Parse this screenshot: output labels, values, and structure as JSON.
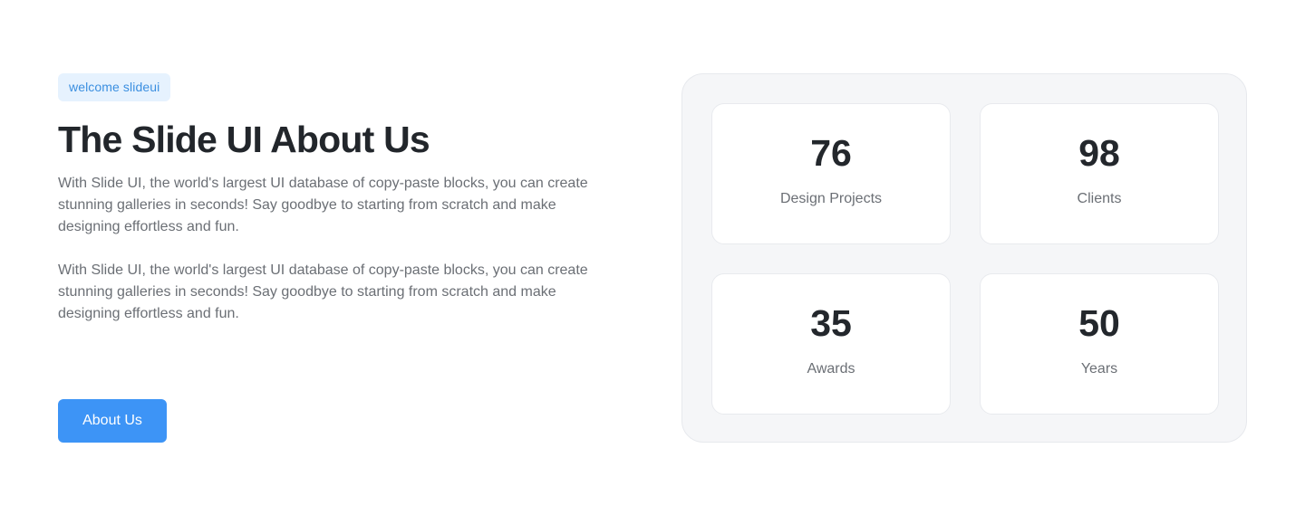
{
  "hero": {
    "badge": "welcome slideui",
    "title": "The Slide UI About Us",
    "paragraphs": [
      "With Slide UI, the world's largest UI database of copy-paste blocks, you can create stunning galleries in seconds! Say goodbye to starting from scratch and make designing effortless and fun.",
      "With Slide UI, the world's largest UI database of copy-paste blocks, you can create stunning galleries in seconds! Say goodbye to starting from scratch and make designing effortless and fun."
    ],
    "cta_label": "About Us"
  },
  "stats": [
    {
      "value": "76",
      "label": "Design Projects"
    },
    {
      "value": "98",
      "label": "Clients"
    },
    {
      "value": "35",
      "label": "Awards"
    },
    {
      "value": "50",
      "label": "Years"
    }
  ],
  "colors": {
    "accent": "#3d94f6",
    "badge_bg": "#e6f2fe",
    "badge_text": "#3b8fe0",
    "panel_bg": "#f5f6f8",
    "heading": "#22262b",
    "body_text": "#6b6f75"
  }
}
